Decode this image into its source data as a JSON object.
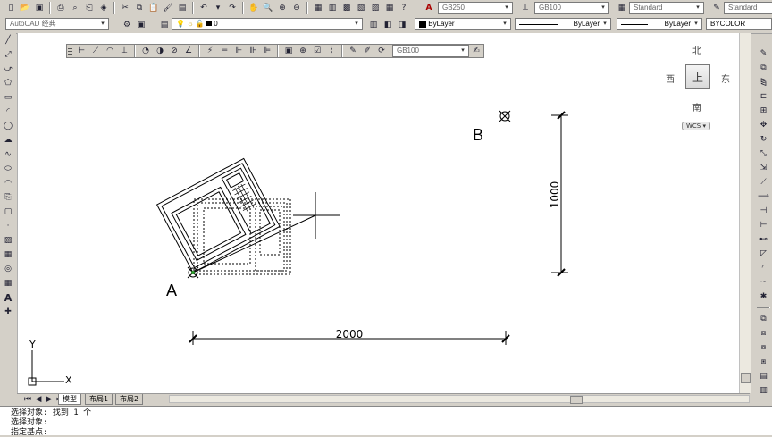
{
  "toolbar_row1": {
    "annotation_style_value": "GB250",
    "dim_style_value": "GB100",
    "table_style_value": "Standard",
    "multileader_style_value": "Standard"
  },
  "toolbar_row2": {
    "workspace_value": "AutoCAD 经典",
    "layer_value": "0",
    "color_value": "ByLayer",
    "linetype_value": "ByLayer",
    "lineweight_value": "ByLayer",
    "plotstyle_value": "BYCOLOR"
  },
  "dim_toolbar": {
    "dimstyle_value": "GB100"
  },
  "nav_cube": {
    "north": "北",
    "south": "南",
    "east": "东",
    "west": "西",
    "top_face": "上",
    "wcs": "WCS"
  },
  "drawing": {
    "point_a_label": "A",
    "point_b_label": "B",
    "dim_horizontal": "2000",
    "dim_vertical": "1000",
    "ucs_y": "Y",
    "ucs_x": "X"
  },
  "tabs": [
    {
      "label": "模型"
    },
    {
      "label": "布局1"
    },
    {
      "label": "布局2"
    }
  ],
  "command_history": [
    "选择对象: 找到 1 个",
    "选择对象:",
    "指定基点:"
  ],
  "icons": {
    "left_toolbar": [
      "line-icon",
      "construction-line-icon",
      "polyline-icon",
      "polygon-icon",
      "rectangle-icon",
      "arc-icon",
      "circle-icon",
      "revcloud-icon",
      "spline-icon",
      "ellipse-icon",
      "ellipse-arc-icon",
      "insert-block-icon",
      "make-block-icon",
      "point-icon",
      "hatch-icon",
      "gradient-icon",
      "region-icon",
      "table-icon",
      "mtext-icon",
      "add-selected-icon"
    ],
    "right_toolbar": [
      "erase-icon",
      "copy-icon",
      "mirror-icon",
      "offset-icon",
      "array-icon",
      "move-icon",
      "rotate-icon",
      "scale-icon",
      "stretch-icon",
      "trim-icon",
      "extend-icon",
      "break-at-point-icon",
      "break-icon",
      "join-icon",
      "chamfer-icon",
      "fillet-icon",
      "blend-icon",
      "explode-icon"
    ]
  }
}
